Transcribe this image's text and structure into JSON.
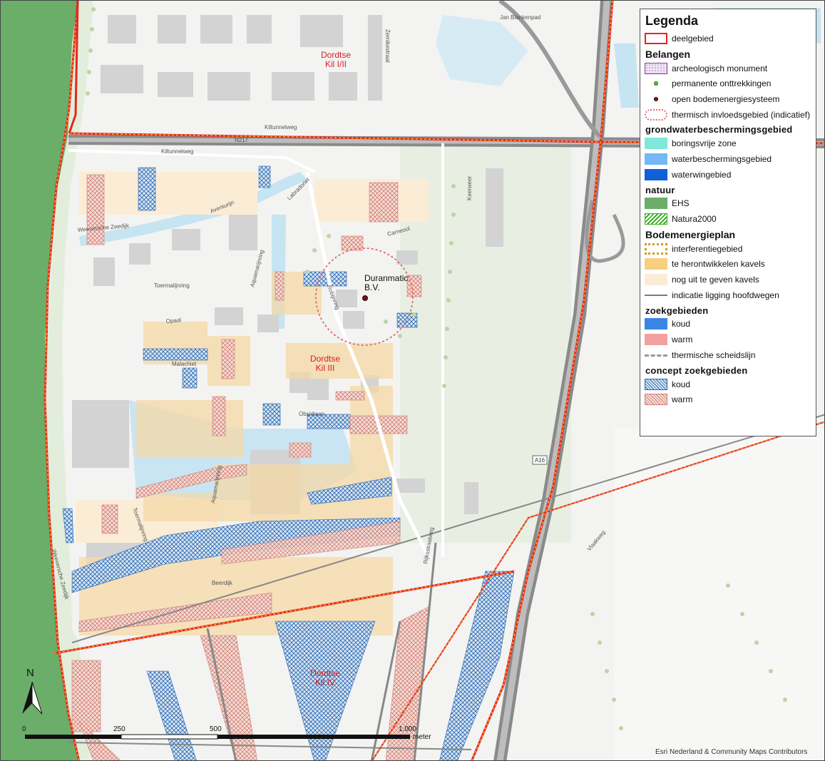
{
  "map": {
    "area_labels": [
      "Dordtse\nKil I/II",
      "Dordtse\nKil III",
      "Dordtse\nKil IV"
    ],
    "marker_label": "Duranmatic\nB.V.",
    "street_labels": [
      "Jan Blankenpad",
      "Zernikestraat",
      "Kiltunnelweg",
      "Kiltunnelweg",
      "N217",
      "Aventurijn",
      "Labradoriet",
      "Carneool",
      "Keerweer",
      "Weeversche Zeedijk",
      "Toermalijnring",
      "Aquamarijnring",
      "Robijnring",
      "Opaal",
      "Malachiet",
      "Obsidiaan",
      "Aquamarijnring",
      "Toermalijnring",
      "Weeversche Zeedijk",
      "Beerdijk",
      "Rijksstraatweg",
      "Vlaakweg",
      "A16"
    ],
    "north_label": "N",
    "scale": {
      "ticks": [
        "0",
        "250",
        "500",
        "1.000"
      ],
      "unit": "meter"
    },
    "credit": "Esri Nederland & Community Maps Contributors",
    "colors": {
      "nature": "#6aae6a",
      "water": "#c6e4f2",
      "boundary": "#e6261f",
      "interference": "#f2b030",
      "redevelop": "#f5d9a6",
      "nog_uit": "#fbecd6",
      "concept_koud": "#1f63b0",
      "concept_warm": "#d08a80",
      "roads": "#7a7a7a"
    }
  },
  "legend": {
    "title": "Legenda",
    "deelgebied": "deelgebied",
    "belangen": {
      "title": "Belangen",
      "items": [
        "archeologisch monument",
        "permanente onttrekkingen",
        "open bodemenergiesysteem",
        "thermisch invloedsgebied (indicatief)"
      ]
    },
    "grondwater": {
      "title": "grondwaterbeschermingsgebied",
      "items": [
        "boringsvrije zone",
        "waterbeschermingsgebied",
        "waterwingebied"
      ]
    },
    "natuur": {
      "title": "natuur",
      "items": [
        "EHS",
        "Natura2000"
      ]
    },
    "bodemenergieplan": {
      "title": "Bodemenergieplan",
      "items": [
        "interferentiegebied",
        "te herontwikkelen kavels",
        "nog uit te geven kavels",
        "indicatie ligging hoofdwegen"
      ]
    },
    "zoekgebieden": {
      "title": "zoekgebieden",
      "items": [
        "koud",
        "warm",
        "thermische scheidslijn"
      ]
    },
    "concept": {
      "title": "concept zoekgebieden",
      "items": [
        "koud",
        "warm"
      ]
    }
  }
}
